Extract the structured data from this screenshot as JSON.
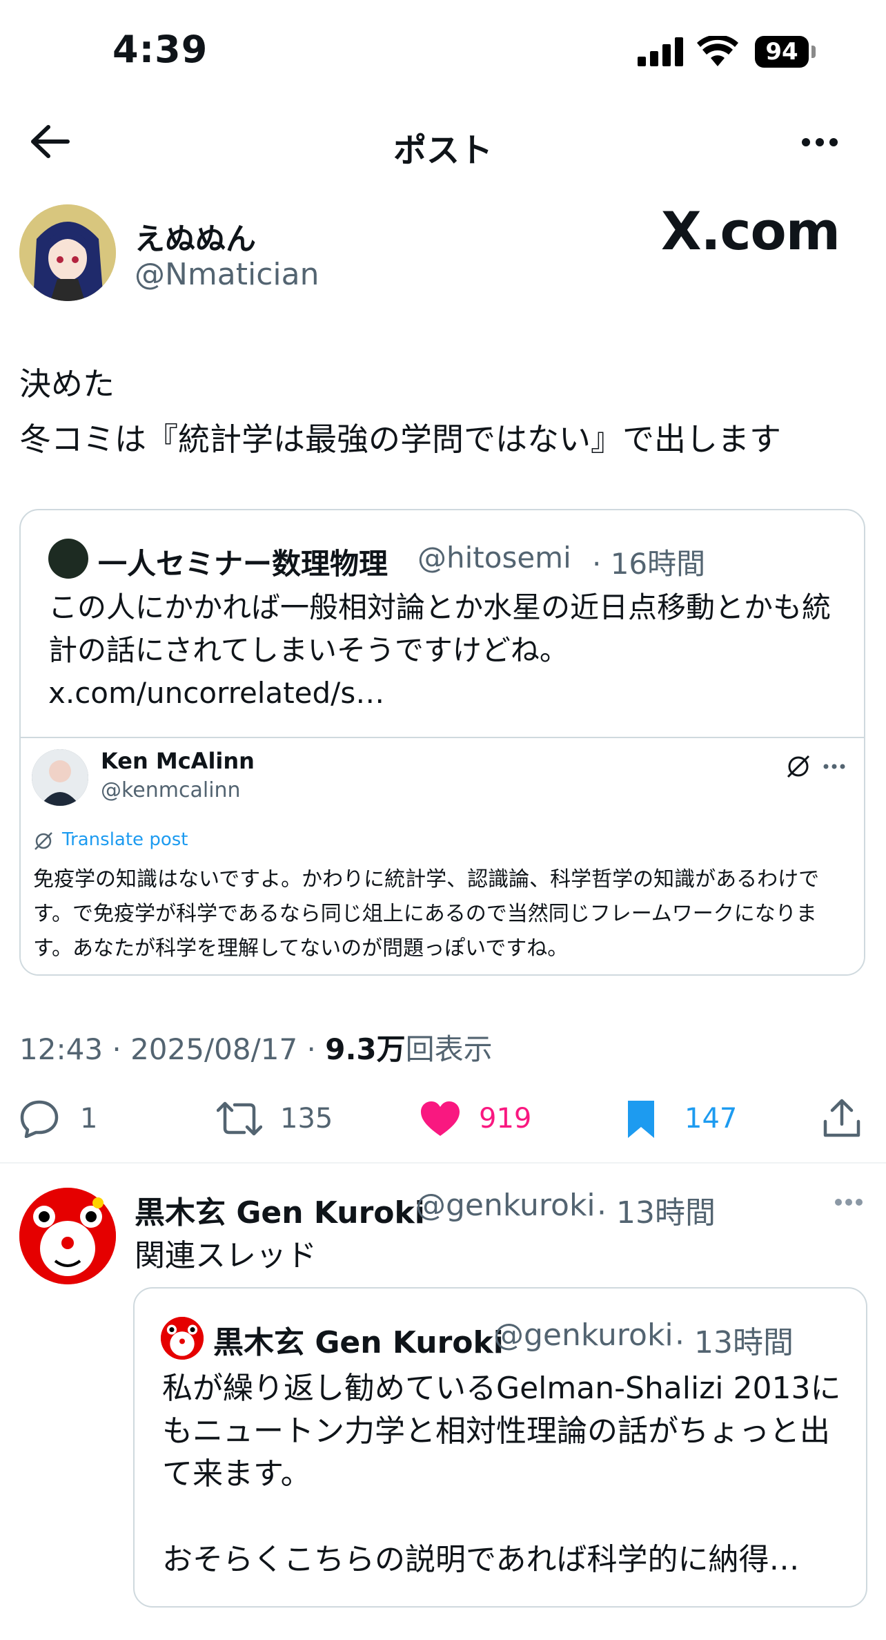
{
  "status_bar": {
    "time": "4:39",
    "battery": "94"
  },
  "nav": {
    "title": "ポスト"
  },
  "post": {
    "author_name": "えぬぬん",
    "author_handle": "@Nmatician",
    "brand": "X.com",
    "text": "決めた\n冬コミは『統計学は最強の学問ではない』で出します",
    "timestamp": "12:43 · 2025/08/17 · ",
    "views_count": "9.3万",
    "views_label": "回表示",
    "replies": "1",
    "reposts": "135",
    "likes": "919",
    "bookmarks": "147"
  },
  "quote": {
    "name": "一人セミナー数理物理",
    "handle": "@hitosemi",
    "time": "· 16時間",
    "text": "この人にかかれば一般相対論とか水星の近日点移動とかも統計の話にされてしまいそうですけどね。 x.com/uncorrelated/s…",
    "embedded": {
      "name": "Ken McAlinn",
      "handle": "@kenmcalinn",
      "translate": "Translate post",
      "text": "免疫学の知識はないですよ。かわりに統計学、認識論、科学哲学の知識があるわけです。で免疫学が科学であるなら同じ俎上にあるので当然同じフレームワークになります。あなたが科学を理解してないのが問題っぽいですね。"
    }
  },
  "reply": {
    "name": "黒木玄 Gen Kuroki",
    "handle": "@genkuroki",
    "time": "· 13時間",
    "text": "関連スレッド",
    "quote": {
      "name": "黒木玄 Gen Kuroki",
      "handle": "@genkuroki",
      "time": "· 13時間",
      "text": "私が繰り返し勧めているGelman-Shalizi 2013にもニュートン力学と相対性理論の話がちょっと出て来ます。\n\nおそらくこちらの説明であれば科学的に納得…"
    }
  },
  "colors": {
    "like": "#f91880",
    "bookmark": "#1d9bf0",
    "muted": "#536471"
  }
}
